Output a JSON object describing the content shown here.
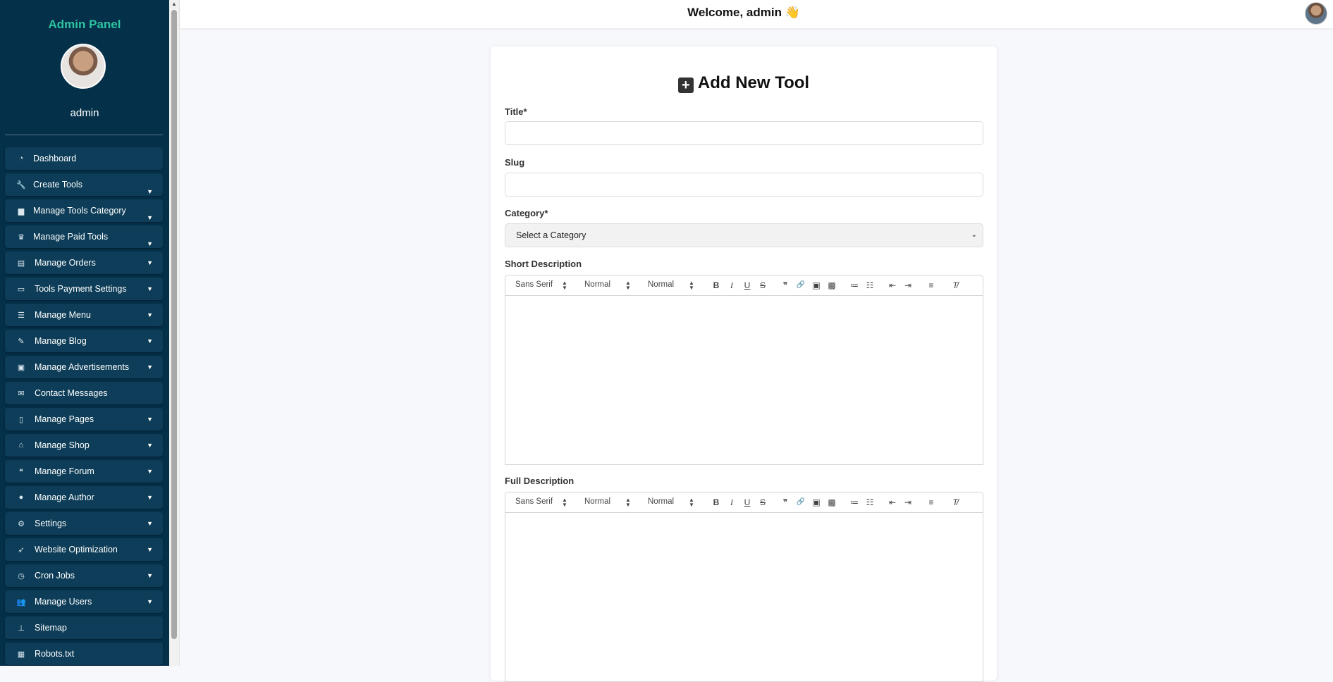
{
  "sidebar": {
    "title": "Admin Panel",
    "username": "admin",
    "items": [
      {
        "label": "Dashboard",
        "icon": "gauge-icon",
        "glyph": "◔",
        "caret": ""
      },
      {
        "label": "Create Tools",
        "icon": "wrench-icon",
        "glyph": "🔧",
        "caret": "▼"
      },
      {
        "label": "Manage Tools Category",
        "icon": "folder-icon",
        "glyph": "▆",
        "caret": "▼"
      },
      {
        "label": "Manage Paid Tools",
        "icon": "crown-icon",
        "glyph": "♛",
        "caret": "▼"
      },
      {
        "label": "Manage Orders",
        "icon": "receipt-icon",
        "glyph": "▤",
        "caret": "▼"
      },
      {
        "label": "Tools Payment Settings",
        "icon": "credit-card-icon",
        "glyph": "▭",
        "caret": "▼"
      },
      {
        "label": "Manage Menu",
        "icon": "bars-icon",
        "glyph": "☰",
        "caret": "▼"
      },
      {
        "label": "Manage Blog",
        "icon": "blog-icon",
        "glyph": "✎",
        "caret": "▼"
      },
      {
        "label": "Manage Advertisements",
        "icon": "ad-icon",
        "glyph": "▣",
        "caret": "▼"
      },
      {
        "label": "Contact Messages",
        "icon": "envelope-icon",
        "glyph": "✉",
        "caret": ""
      },
      {
        "label": "Manage Pages",
        "icon": "file-icon",
        "glyph": "▯",
        "caret": "▼"
      },
      {
        "label": "Manage Shop",
        "icon": "store-icon",
        "glyph": "⌂",
        "caret": "▼"
      },
      {
        "label": "Manage Forum",
        "icon": "comments-icon",
        "glyph": "❝",
        "caret": "▼"
      },
      {
        "label": "Manage Author",
        "icon": "user-icon",
        "glyph": "●",
        "caret": "▼"
      },
      {
        "label": "Settings",
        "icon": "gears-icon",
        "glyph": "⚙",
        "caret": "▼"
      },
      {
        "label": "Website Optimization",
        "icon": "rocket-icon",
        "glyph": "➶",
        "caret": "▼"
      },
      {
        "label": "Cron Jobs",
        "icon": "clock-icon",
        "glyph": "◷",
        "caret": "▼"
      },
      {
        "label": "Manage Users",
        "icon": "users-icon",
        "glyph": "👥",
        "caret": "▼"
      },
      {
        "label": "Sitemap",
        "icon": "sitemap-icon",
        "glyph": "⊥",
        "caret": ""
      },
      {
        "label": "Robots.txt",
        "icon": "robot-icon",
        "glyph": "▦",
        "caret": ""
      }
    ]
  },
  "topbar": {
    "welcome": "Welcome, admin 👋"
  },
  "form": {
    "heading": "Add New Tool",
    "title_label": "Title*",
    "title_value": "",
    "slug_label": "Slug",
    "slug_value": "",
    "category_label": "Category*",
    "category_selected": "Select a Category",
    "short_desc_label": "Short Description",
    "full_desc_label": "Full Description"
  },
  "editor_toolbar": {
    "font": "Sans Serif",
    "size": "Normal",
    "header": "Normal"
  }
}
